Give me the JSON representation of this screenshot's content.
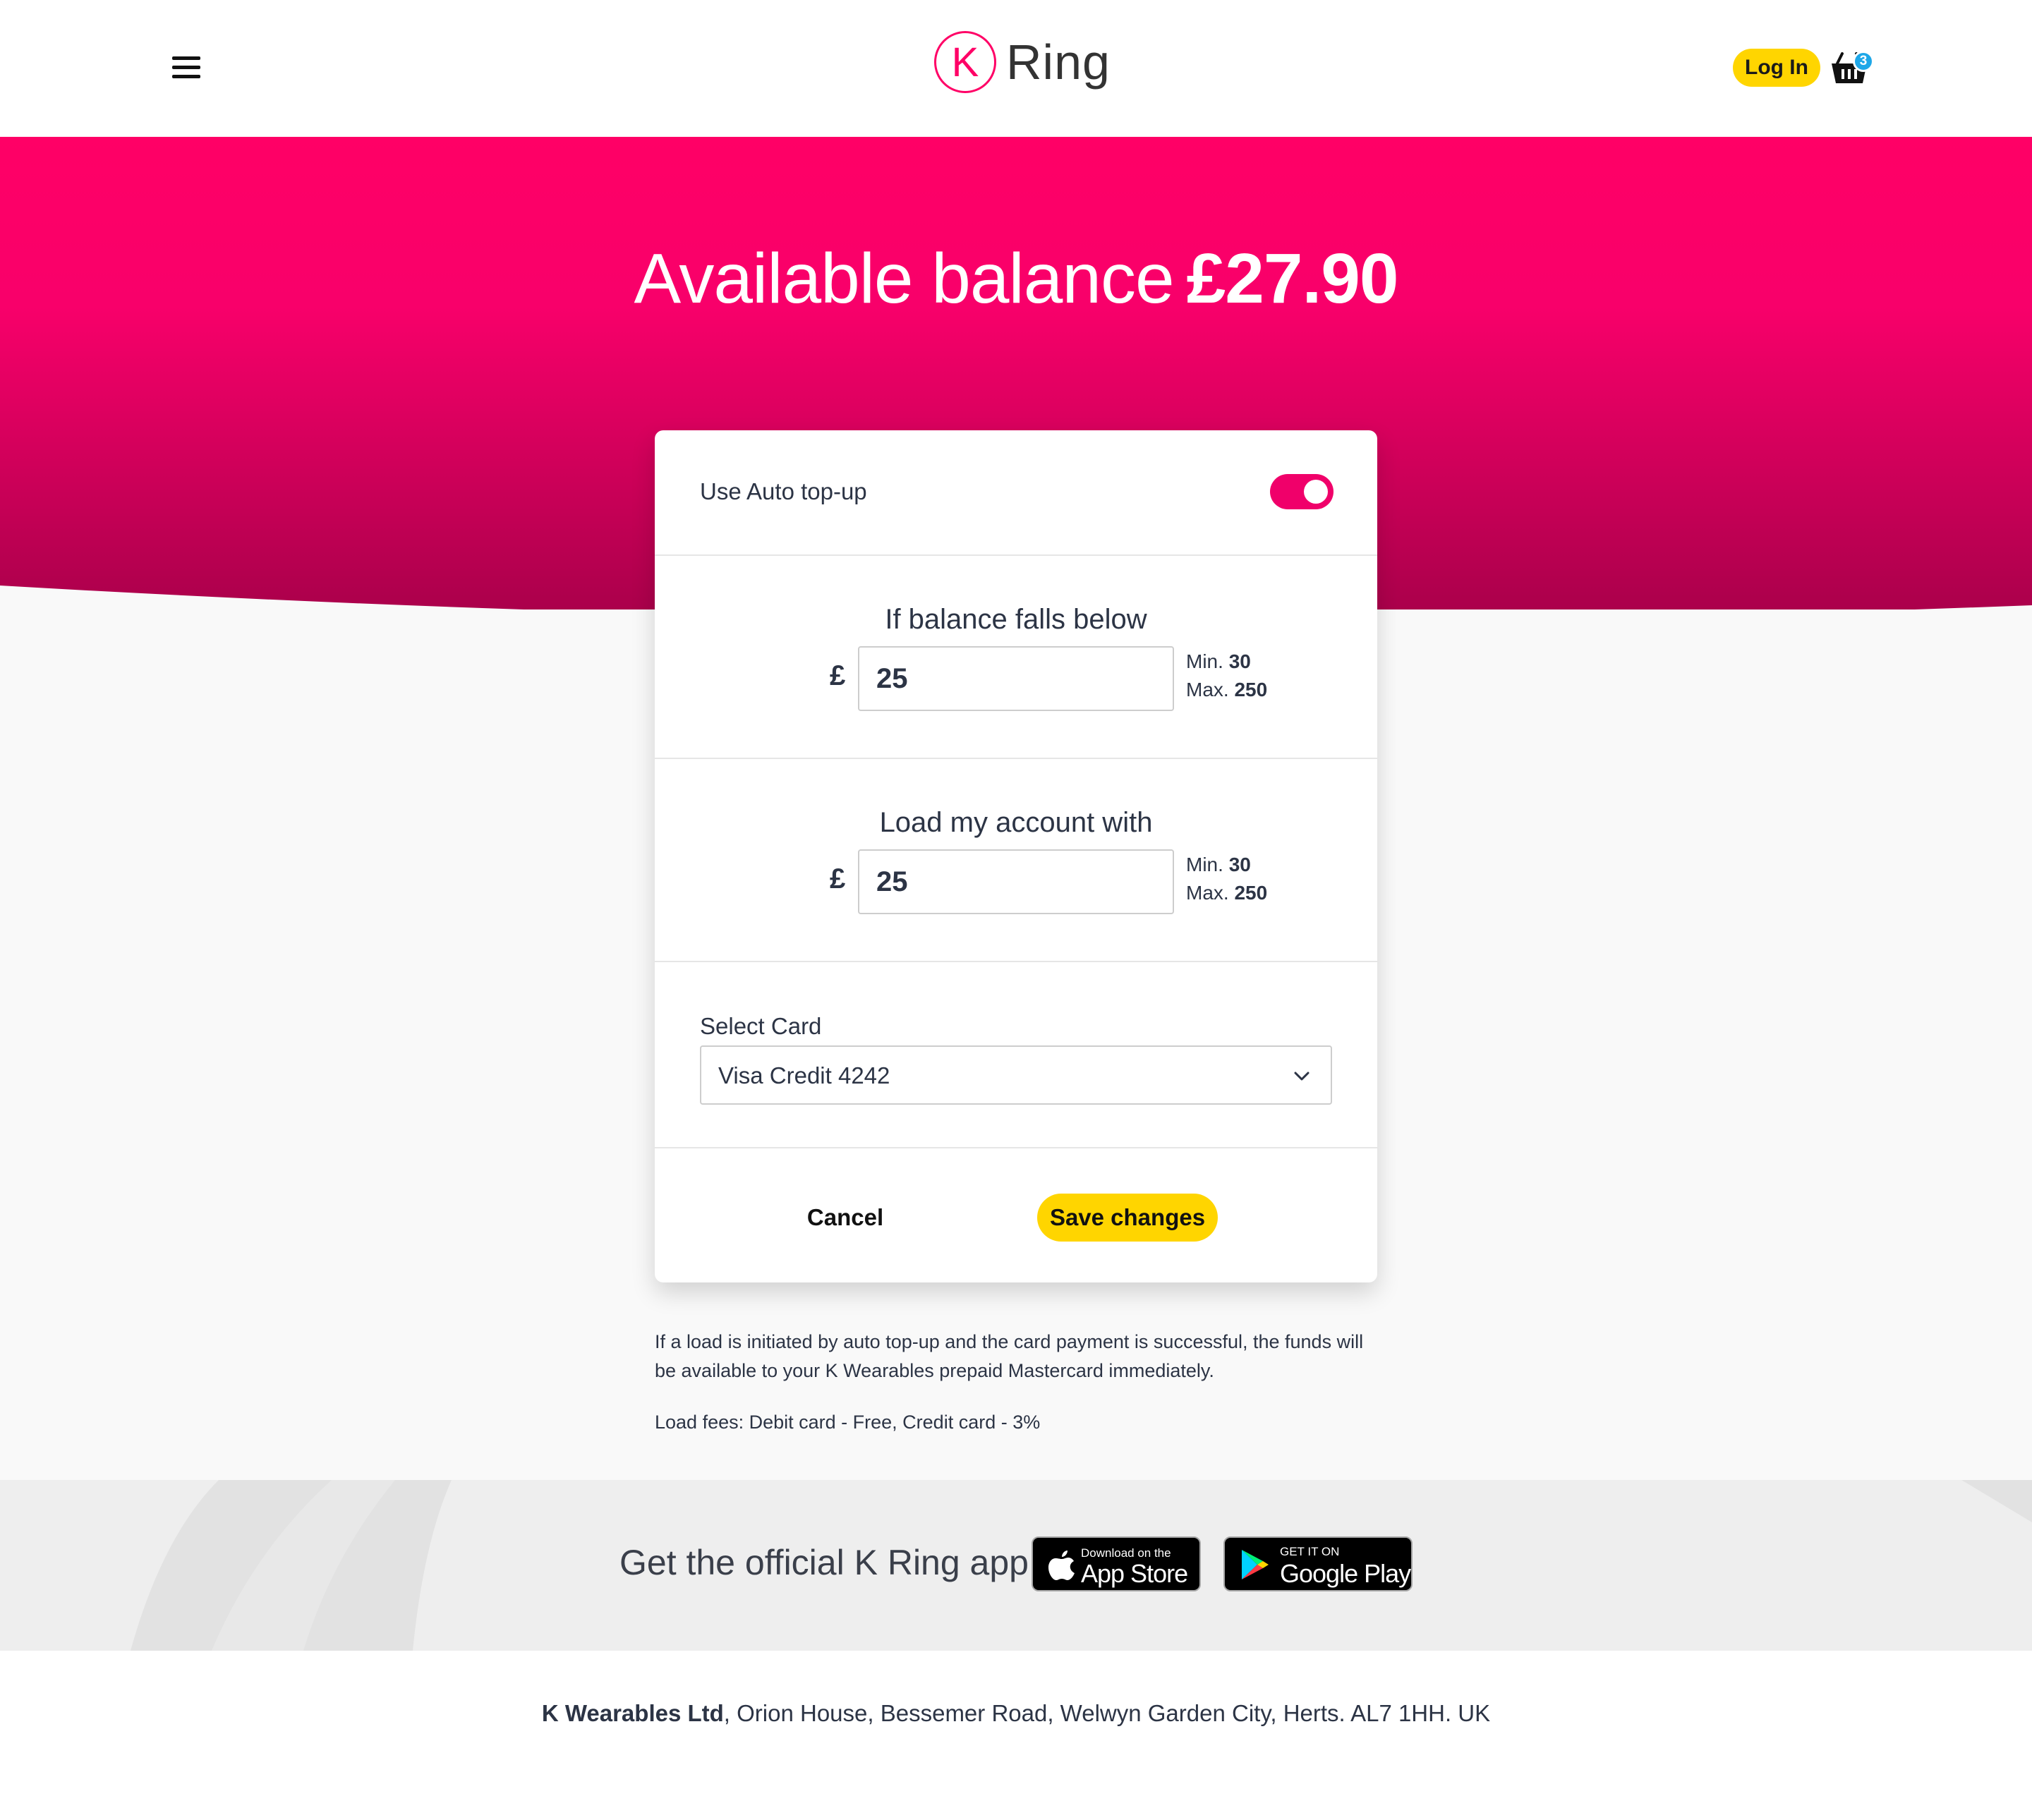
{
  "header": {
    "logo_letter": "K",
    "logo_text": "Ring",
    "login_label": "Log In",
    "basket_count": "3"
  },
  "hero": {
    "balance_label": "Available balance",
    "balance_amount": "£27.90"
  },
  "auto_topup": {
    "label": "Use Auto top-up",
    "enabled": true
  },
  "threshold": {
    "title": "If balance falls below",
    "currency": "£",
    "value": "25",
    "min_label": "Min.",
    "min_value": "30",
    "max_label": "Max.",
    "max_value": "250"
  },
  "load_amount": {
    "title": "Load my account with",
    "currency": "£",
    "value": "25",
    "min_label": "Min.",
    "min_value": "30",
    "max_label": "Max.",
    "max_value": "250"
  },
  "card_select": {
    "label": "Select Card",
    "selected": "Visa Credit 4242"
  },
  "actions": {
    "cancel_label": "Cancel",
    "save_label": "Save changes"
  },
  "notes": {
    "auto_topup_info": "If a load is initiated by auto top-up and the card payment is successful, the funds will be available to your K Wearables prepaid Mastercard immediately.",
    "fees": "Load fees: Debit card - Free, Credit card - 3%"
  },
  "app_banner": {
    "text": "Get the official K Ring app",
    "appstore_small": "Download on the",
    "appstore_big": "App Store",
    "googleplay_small": "GET IT ON",
    "googleplay_big": "Google Play"
  },
  "footer": {
    "company": "K Wearables Ltd",
    "address": ", Orion House, Bessemer Road, Welwyn Garden City, Herts. AL7 1HH. UK"
  },
  "colors": {
    "brand_pink": "#ff0066",
    "accent_yellow": "#ffd500",
    "badge_blue": "#1ea7e8"
  }
}
